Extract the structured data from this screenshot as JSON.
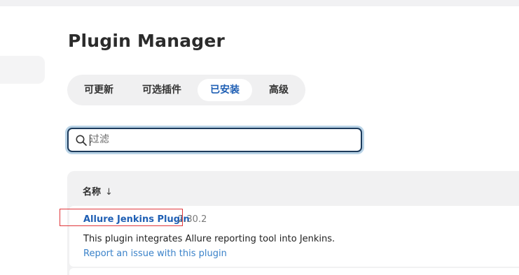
{
  "page": {
    "title": "Plugin Manager"
  },
  "tabs": [
    {
      "label": "可更新",
      "active": false
    },
    {
      "label": "可选插件",
      "active": false
    },
    {
      "label": "已安装",
      "active": true
    },
    {
      "label": "高级",
      "active": false
    }
  ],
  "search": {
    "placeholder": "过滤",
    "value": ""
  },
  "table": {
    "name_header": "名称",
    "sort_indicator": "↓",
    "rows": [
      {
        "name": "Allure Jenkins Plugin",
        "version": "2.30.2",
        "description": "This plugin integrates Allure reporting tool into Jenkins.",
        "report_link": "Report an issue with this plugin"
      }
    ]
  },
  "colors": {
    "accent": "#1f5fb4",
    "link": "#3a82c9",
    "focus_ring": "#b9d3e6",
    "annotation": "#e0363a"
  },
  "icons": {
    "search": "search-icon"
  }
}
